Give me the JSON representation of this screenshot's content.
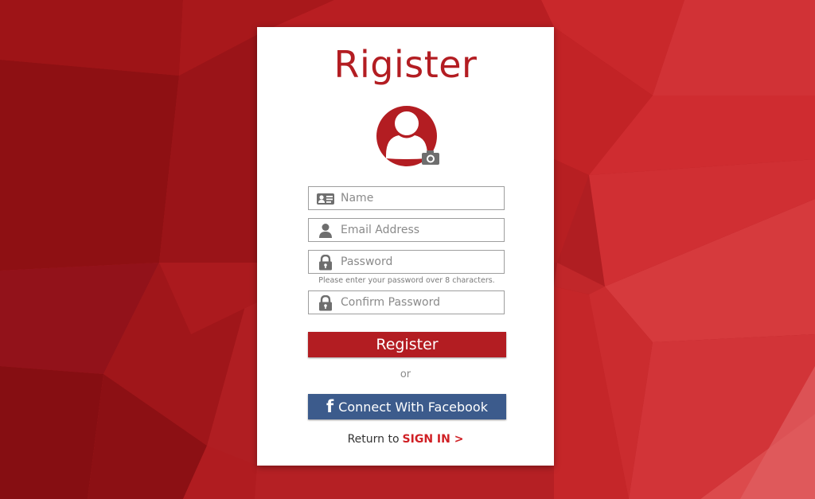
{
  "colors": {
    "brand_red": "#b31d22",
    "facebook_blue": "#3c5b8c",
    "signin_red": "#d02025"
  },
  "form": {
    "title": "Rigister",
    "avatar_icon": "user-icon",
    "camera_icon": "camera-icon",
    "fields": {
      "name": {
        "placeholder": "Name",
        "icon": "id-card-icon"
      },
      "email": {
        "placeholder": "Email Address",
        "icon": "user-icon"
      },
      "password": {
        "placeholder": "Password",
        "icon": "lock-icon"
      },
      "confirm_password": {
        "placeholder": "Confirm Password",
        "icon": "lock-icon"
      }
    },
    "password_hint": "Please enter your password over 8 characters.",
    "register_button": "Register",
    "or_text": "or",
    "facebook_icon": "f",
    "facebook_button": "Connect With Facebook",
    "return_text": "Return to",
    "signin_link": "SIGN IN >"
  }
}
